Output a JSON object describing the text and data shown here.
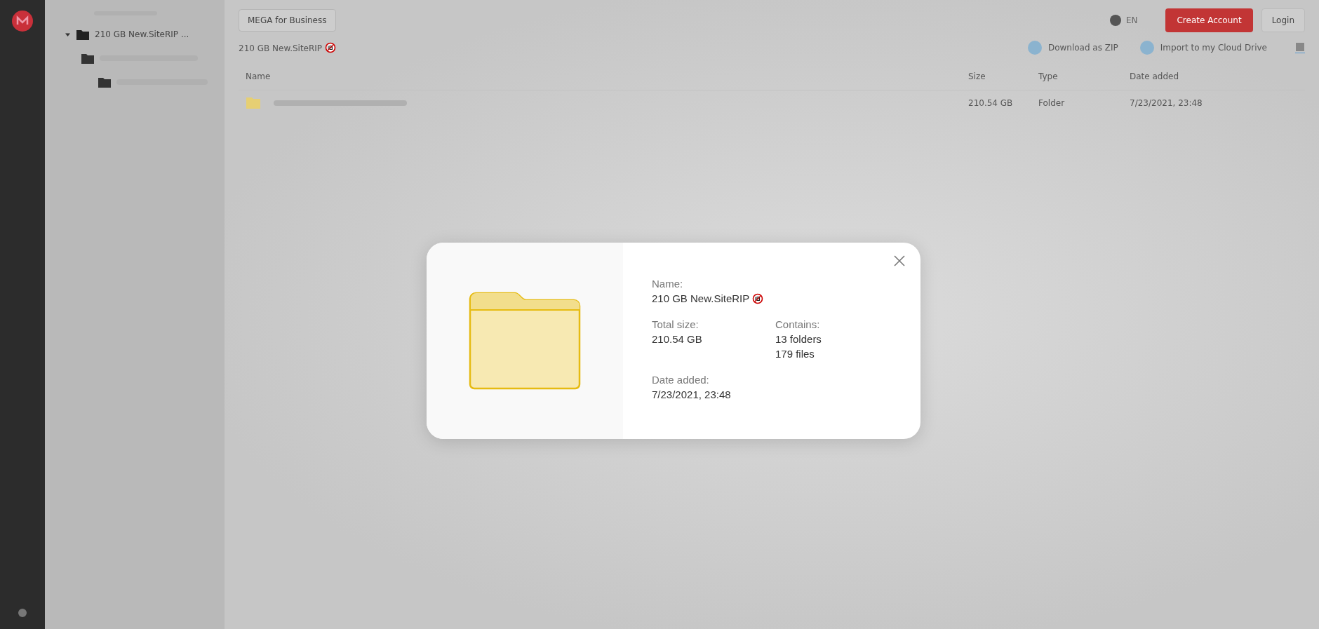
{
  "background": {
    "sidebar": {
      "tree": [
        {
          "label": "210 GB New.SiteRIP ...",
          "expanded": true
        }
      ]
    },
    "topbar": {
      "business_button": "MEGA for Business",
      "language": "EN",
      "create_account": "Create Account",
      "login": "Login"
    },
    "breadcrumb": "210 GB New.SiteRIP",
    "actions": [
      "Download as ZIP",
      "Import to my Cloud Drive"
    ],
    "table": {
      "columns": [
        "Name",
        "Size",
        "Type",
        "Date added"
      ],
      "rows": [
        {
          "size": "210.54 GB",
          "type": "Folder",
          "date": "7/23/2021, 23:48"
        }
      ]
    }
  },
  "dialog": {
    "name_label": "Name:",
    "name": "210 GB New.SiteRIP",
    "total_size_label": "Total size:",
    "total_size": "210.54 GB",
    "contains_label": "Contains:",
    "contains": [
      "13 folders",
      "179 files"
    ],
    "date_label": "Date added:",
    "date": "7/23/2021, 23:48"
  }
}
